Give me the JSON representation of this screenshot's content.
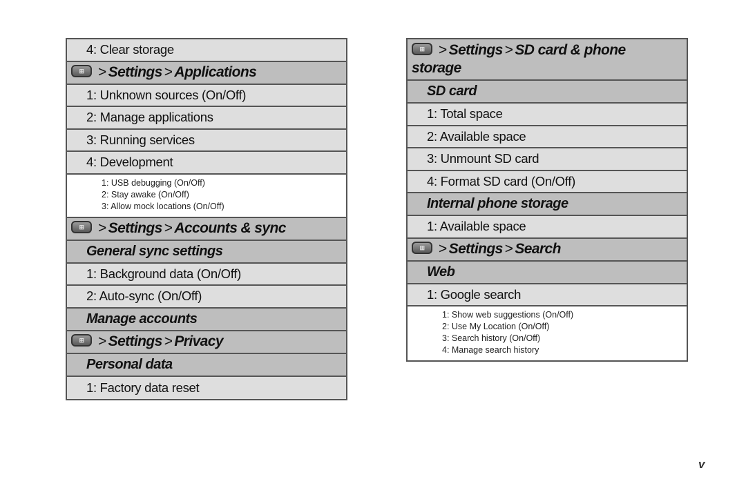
{
  "left": {
    "rows": [
      {
        "type": "item",
        "text": "4: Clear storage"
      },
      {
        "type": "path",
        "parts": [
          "Settings",
          "Applications"
        ]
      },
      {
        "type": "item",
        "text": "1: Unknown sources (On/Off)"
      },
      {
        "type": "item",
        "text": "2: Manage applications"
      },
      {
        "type": "item",
        "text": "3: Running services"
      },
      {
        "type": "item",
        "text": "4: Development"
      },
      {
        "type": "detail",
        "lines": [
          "1: USB debugging (On/Off)",
          "2: Stay awake (On/Off)",
          "3: Allow mock locations (On/Off)"
        ]
      },
      {
        "type": "path",
        "parts": [
          "Settings",
          "Accounts & sync"
        ]
      },
      {
        "type": "sub",
        "text": "General sync settings"
      },
      {
        "type": "item",
        "text": "1: Background data (On/Off)"
      },
      {
        "type": "item",
        "text": "2: Auto-sync (On/Off)"
      },
      {
        "type": "sub",
        "text": "Manage accounts"
      },
      {
        "type": "path",
        "parts": [
          "Settings",
          "Privacy"
        ]
      },
      {
        "type": "sub",
        "text": "Personal data"
      },
      {
        "type": "item",
        "text": "1: Factory data reset"
      }
    ]
  },
  "right": {
    "rows": [
      {
        "type": "path",
        "wrap": true,
        "parts": [
          "Settings",
          "SD card & phone"
        ],
        "continuation": "storage"
      },
      {
        "type": "sub",
        "text": "SD card"
      },
      {
        "type": "item",
        "text": "1: Total space"
      },
      {
        "type": "item",
        "text": "2: Available space"
      },
      {
        "type": "item",
        "text": "3: Unmount SD card"
      },
      {
        "type": "item",
        "text": "4: Format SD card (On/Off)"
      },
      {
        "type": "sub",
        "text": "Internal phone storage"
      },
      {
        "type": "item",
        "text": "1: Available space"
      },
      {
        "type": "path",
        "parts": [
          "Settings",
          "Search"
        ]
      },
      {
        "type": "sub",
        "text": "Web"
      },
      {
        "type": "item",
        "text": "1: Google search"
      },
      {
        "type": "detail",
        "lines": [
          "1: Show web suggestions (On/Off)",
          "2: Use My Location (On/Off)",
          "3: Search history (On/Off)",
          "4: Manage search history"
        ]
      }
    ]
  },
  "separator": ">",
  "icons": {
    "home_key": "home-key-icon"
  },
  "page_number": "v"
}
